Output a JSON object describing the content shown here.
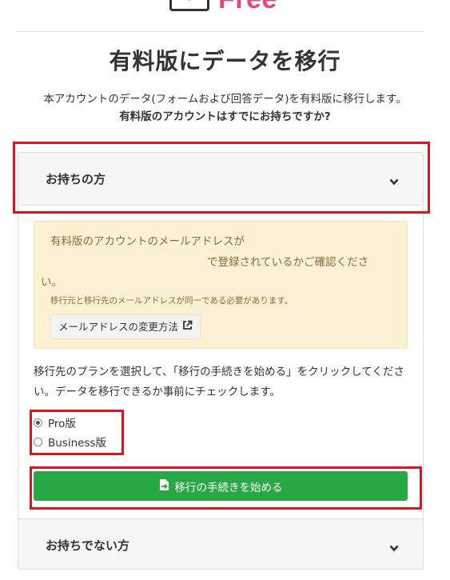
{
  "logo": {
    "text": "Free"
  },
  "page_title": "有料版にデータを移行",
  "intro": {
    "line1": "本アカウントのデータ(フォームおよび回答データ)を有料版に移行します。",
    "question": "有料版のアカウントはすでにお持ちですか?"
  },
  "accordion": {
    "have": {
      "title": "お持ちの方"
    },
    "not_have": {
      "title": "お持ちでない方"
    }
  },
  "notice": {
    "line1": "有料版のアカウントのメールアドレスが",
    "line2": "で登録されているかご確認くださ",
    "line3": "い。",
    "note": "移行元と移行先のメールアドレスが同一である必要があります。",
    "change_email_label": "メールアドレスの変更方法"
  },
  "instruction": "移行先のプランを選択して、「移行の手続きを始める」をクリックしてください。データを移行できるか事前にチェックします。",
  "plans": [
    {
      "label": "Pro版",
      "selected": true
    },
    {
      "label": "Business版",
      "selected": false
    }
  ],
  "start_button": {
    "label": "移行の手続きを始める"
  },
  "colors": {
    "brand": "#e8457c",
    "start_button": "#28a745",
    "notice_bg": "#fcf1d3",
    "notice_text": "#8a6d3b",
    "highlight": "#e0141e"
  }
}
